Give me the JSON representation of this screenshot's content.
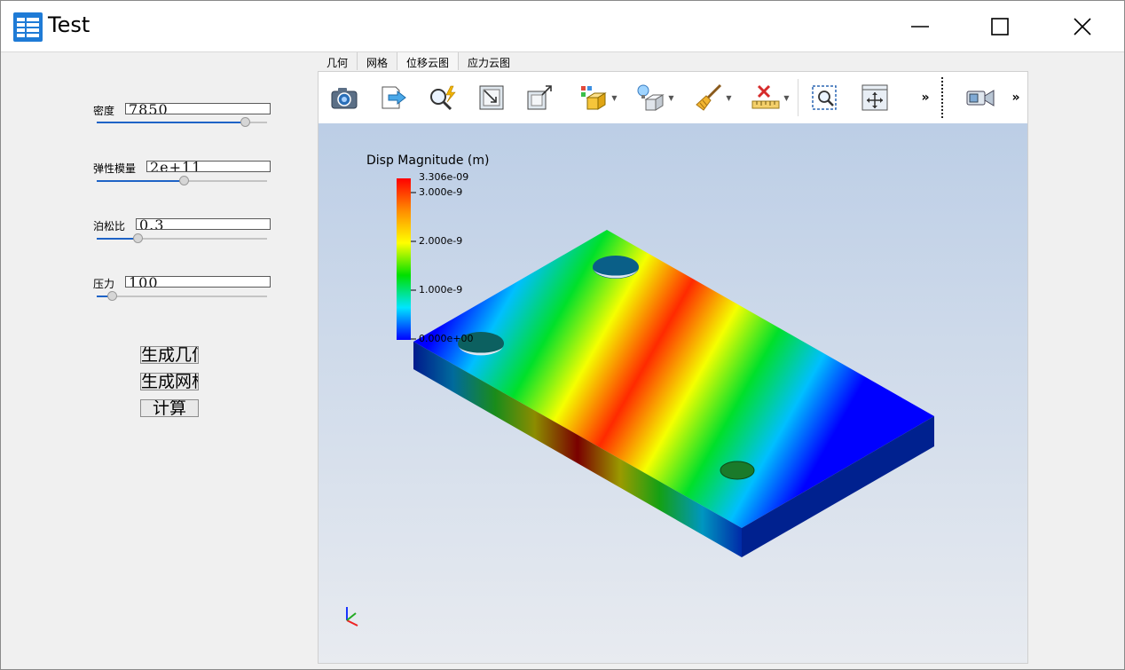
{
  "window": {
    "title": "Test",
    "icon": "app-grid-icon",
    "controls": [
      "minimize-icon",
      "maximize-icon",
      "close-icon"
    ]
  },
  "params": [
    {
      "label": "密度",
      "value": "7850",
      "slider_fraction": 0.87
    },
    {
      "label": "弹性模量",
      "value": "2e+11",
      "slider_fraction": 0.51
    },
    {
      "label": "泊松比",
      "value": "0.3",
      "slider_fraction": 0.24
    },
    {
      "label": "压力",
      "value": "100",
      "slider_fraction": 0.09
    }
  ],
  "actions": {
    "generate_geometry": "生成几何",
    "generate_mesh": "生成网格",
    "compute": "计算"
  },
  "tabs": [
    "几何",
    "网格",
    "位移云图",
    "应力云图"
  ],
  "toolbar": {
    "tools": [
      "camera-icon",
      "export-icon",
      "zoom-select-icon",
      "reset-view-icon",
      "fit-view-icon",
      "box-color-icon",
      "light-icon",
      "broom-icon",
      "ruler-icon",
      "zoom-box-icon",
      "move-icon",
      "overflow-icon",
      "video-camera-icon",
      "overflow-icon"
    ],
    "overflow_label": "»"
  },
  "scene": {
    "colorbar": {
      "title": "Disp Magnitude (m)",
      "max_label": "3.306e-09",
      "tick_labels": [
        "3.000e-9",
        "2.000e-9",
        "1.000e-9",
        "0.000e+00"
      ],
      "colors": [
        "#ff0000",
        "#ff8c00",
        "#ffff00",
        "#00e000",
        "#00e5ff",
        "#0000ff"
      ]
    },
    "background_top": "#bccdE6",
    "background_bottom": "#e7eaef",
    "axes_icon": "axes-triad-icon"
  }
}
